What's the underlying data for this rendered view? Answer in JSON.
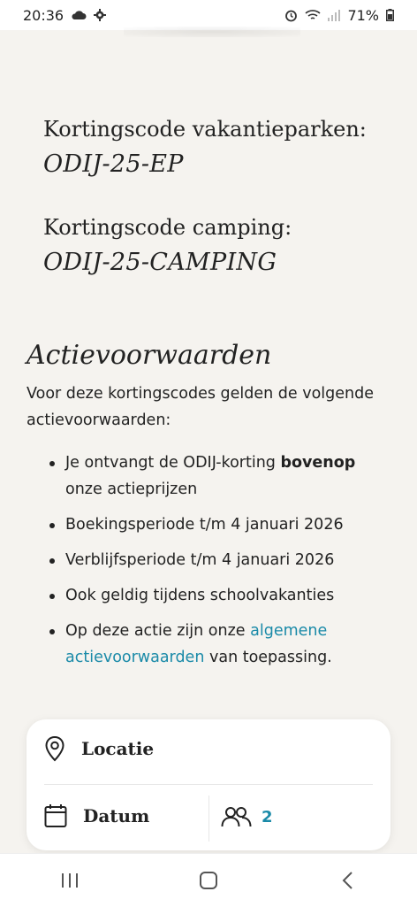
{
  "status_bar": {
    "time": "20:36",
    "battery_percent": "71%",
    "left_icons": [
      "cloud-icon",
      "gear-icon"
    ],
    "right_icons": [
      "alarm-icon",
      "wifi-icon",
      "signal-icon",
      "battery-icon"
    ]
  },
  "codes": [
    {
      "label": "Kortingscode vakantieparken:",
      "value": "ODIJ-25-EP"
    },
    {
      "label": "Kortingscode camping:",
      "value": "ODIJ-25-CAMPING"
    }
  ],
  "conditions": {
    "title": "Actievoorwaarden",
    "intro": "Voor deze kortingscodes gelden de volgende actievoorwaarden:",
    "item1": {
      "before": "Je ontvangt de ODIJ-korting ",
      "bold": "bovenop",
      "after": " onze actieprijzen"
    },
    "item2": "Boekingsperiode t/m 4 januari 2026",
    "item3": "Verblijfsperiode t/m 4 januari 2026",
    "item4": "Ook geldig tijdens schoolvakanties",
    "item5": {
      "before": "Op deze actie zijn onze ",
      "link": "algemene actievoorwaarden",
      "after": " van toepassing."
    }
  },
  "search_card": {
    "location_label": "Locatie",
    "date_label": "Datum",
    "guests_count": "2"
  },
  "colors": {
    "background": "#f5f3ef",
    "accent_link": "#1a8aa8",
    "text": "#222222"
  },
  "nav_bar": {
    "icons": [
      "recent-apps-icon",
      "home-icon",
      "back-icon"
    ]
  }
}
